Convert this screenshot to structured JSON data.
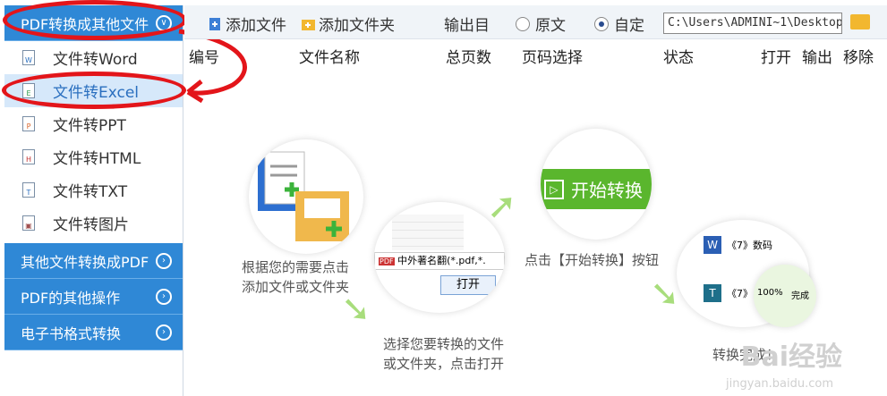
{
  "sidebar": {
    "top_category": "PDF转换成其他文件",
    "items": [
      {
        "label": "文件转Word",
        "icon": "word-file-icon",
        "glyph": "W"
      },
      {
        "label": "文件转Excel",
        "icon": "excel-file-icon",
        "glyph": "E"
      },
      {
        "label": "文件转PPT",
        "icon": "ppt-file-icon",
        "glyph": "P"
      },
      {
        "label": "文件转HTML",
        "icon": "html-file-icon",
        "glyph": "H"
      },
      {
        "label": "文件转TXT",
        "icon": "txt-file-icon",
        "glyph": "T"
      },
      {
        "label": "文件转图片",
        "icon": "image-file-icon",
        "glyph": "▣"
      }
    ],
    "categories": [
      "其他文件转换成PDF",
      "PDF的其他操作",
      "电子书格式转换"
    ]
  },
  "toolbar": {
    "add_file": "添加文件",
    "add_folder": "添加文件夹",
    "output_dir": "输出目",
    "radio_original": "原文",
    "radio_custom": "自定",
    "path": "C:\\Users\\ADMINI~1\\Desktop"
  },
  "columns": {
    "num": "编号",
    "filename": "文件名称",
    "pages": "总页数",
    "page_select": "页码选择",
    "status": "状态",
    "open": "打开",
    "output": "输出",
    "remove": "移除"
  },
  "illustration": {
    "step1": "根据您的需要点击\n添加文件或文件夹",
    "step2": "选择您要转换的文件\n或文件夹，点击打开",
    "step3": "点击【开始转换】按钮",
    "step4": "转换完成！",
    "start_button": "开始转换",
    "dialog_filename": "中外著名翻",
    "dialog_filter": "(*.pdf,*.",
    "dialog_open": "打开",
    "done_item1": "《7》数码",
    "done_item2": "《7》",
    "done_progress": "100%",
    "done_status": "完成"
  },
  "watermark": {
    "main": "Bai经验",
    "sub": "jingyan.baidu.com"
  },
  "colors": {
    "accent": "#2f88d6",
    "green": "#5ab62d",
    "annotation_red": "#e3151a"
  }
}
